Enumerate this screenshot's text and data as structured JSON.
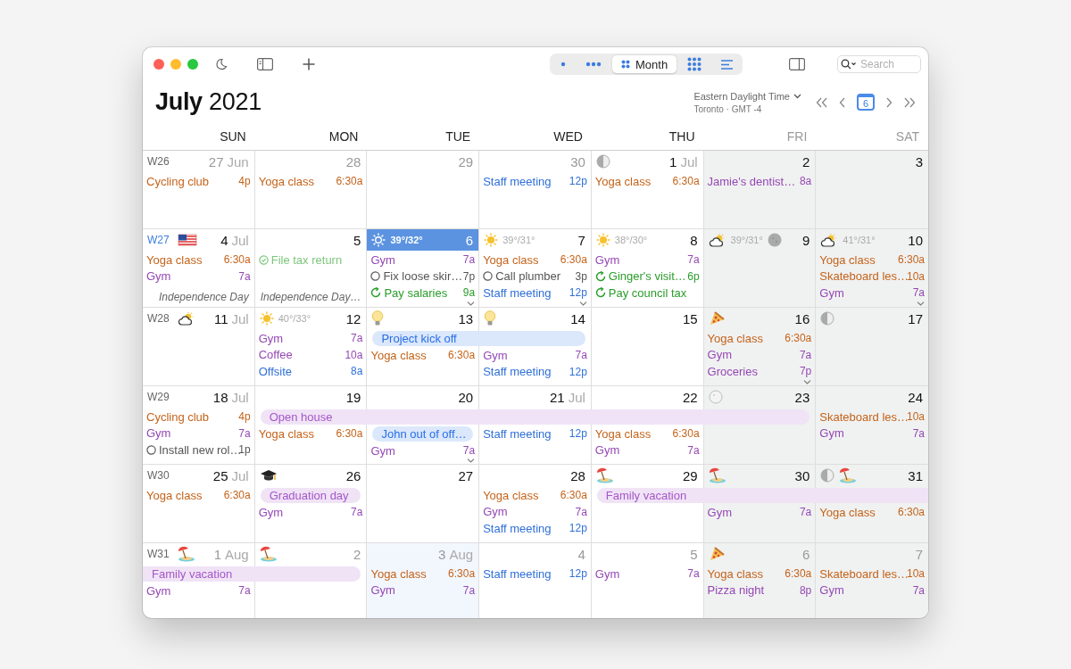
{
  "view_modes": [
    {
      "kind": "day",
      "selected": false
    },
    {
      "kind": "week",
      "selected": false
    },
    {
      "kind": "month",
      "label": "Month",
      "selected": true
    },
    {
      "kind": "year",
      "selected": false
    },
    {
      "kind": "list",
      "selected": false
    }
  ],
  "search": {
    "placeholder": "Search"
  },
  "title": "**July** 2021",
  "timezone": {
    "name": "Eastern Daylight Time",
    "detail": "Toronto · GMT -4"
  },
  "today_button": "6",
  "weekdays": [
    {
      "label": "SUN",
      "muted": false
    },
    {
      "label": "MON",
      "muted": false
    },
    {
      "label": "TUE",
      "muted": false
    },
    {
      "label": "WED",
      "muted": false
    },
    {
      "label": "THU",
      "muted": false
    },
    {
      "label": "FRI",
      "muted": true
    },
    {
      "label": "SAT",
      "muted": true
    }
  ],
  "weeks": [
    {
      "label": "W26",
      "selected": false,
      "days": [
        {
          "number": "27",
          "month": "Jun",
          "muted": true,
          "shaded": false,
          "selected": false,
          "events": [
            {
              "kind": "event",
              "title": "Cycling club",
              "time": "4p",
              "color": "#c4631a"
            }
          ]
        },
        {
          "number": "28",
          "muted": true,
          "shaded": false,
          "selected": false,
          "events": [
            {
              "kind": "event",
              "title": "Yoga class",
              "time": "6:30a",
              "color": "#c4631a"
            }
          ]
        },
        {
          "number": "29",
          "muted": true,
          "shaded": false,
          "selected": false
        },
        {
          "number": "30",
          "muted": true,
          "shaded": false,
          "selected": false,
          "events": [
            {
              "kind": "event",
              "title": "Staff meeting",
              "time": "12p",
              "color": "#2f6fd8"
            }
          ]
        },
        {
          "number": "1",
          "month": "Jul",
          "muted": false,
          "shaded": false,
          "selected": false,
          "icons": [
            {
              "kind": "moon-half"
            }
          ],
          "events": [
            {
              "kind": "event",
              "title": "Yoga class",
              "time": "6:30a",
              "color": "#c4631a"
            }
          ]
        },
        {
          "number": "2",
          "muted": false,
          "shaded": true,
          "selected": false,
          "events": [
            {
              "kind": "event",
              "title": "Jamie's dentist…",
              "time": "8a",
              "color": "#9448b4"
            }
          ]
        },
        {
          "number": "3",
          "muted": false,
          "shaded": true,
          "selected": false
        }
      ]
    },
    {
      "label": "W27",
      "selected": true,
      "days": [
        {
          "number": "4",
          "month": "Jul",
          "muted": false,
          "shaded": false,
          "selected": false,
          "icons": [
            {
              "kind": "flag"
            }
          ],
          "events": [
            {
              "kind": "event",
              "title": "Yoga class",
              "time": "6:30a",
              "color": "#c4631a"
            },
            {
              "kind": "event",
              "title": "Gym",
              "time": "7a",
              "color": "#9448b4"
            }
          ],
          "holiday": "Independence Day"
        },
        {
          "number": "5",
          "muted": false,
          "shaded": false,
          "selected": false,
          "events": [
            {
              "kind": "done",
              "title": "File tax return",
              "color": "#7cc67c"
            }
          ],
          "holiday": "Independence Day…"
        },
        {
          "number": "6",
          "muted": false,
          "shaded": false,
          "selected": true,
          "weather": {
            "kind": "sun",
            "temp": "39°/32°"
          },
          "events": [
            {
              "kind": "event",
              "title": "Gym",
              "time": "7a",
              "color": "#9448b4"
            },
            {
              "kind": "todo",
              "title": "Fix loose skir…",
              "time": "7p",
              "color": "#555555"
            },
            {
              "kind": "repeat",
              "title": "Pay salaries",
              "time": "9a",
              "color": "#2a9d2a"
            }
          ],
          "more": true
        },
        {
          "number": "7",
          "muted": false,
          "shaded": false,
          "selected": false,
          "weather": {
            "kind": "sun",
            "temp": "39°/31°"
          },
          "events": [
            {
              "kind": "event",
              "title": "Yoga class",
              "time": "6:30a",
              "color": "#c4631a"
            },
            {
              "kind": "todo",
              "title": "Call plumber",
              "time": "3p",
              "color": "#555555"
            },
            {
              "kind": "event",
              "title": "Staff meeting",
              "time": "12p",
              "color": "#2f6fd8"
            }
          ],
          "more": true
        },
        {
          "number": "8",
          "muted": false,
          "shaded": false,
          "selected": false,
          "weather": {
            "kind": "sun",
            "temp": "38°/30°"
          },
          "events": [
            {
              "kind": "event",
              "title": "Gym",
              "time": "7a",
              "color": "#9448b4"
            },
            {
              "kind": "repeat",
              "title": "Ginger's visit…",
              "time": "6p",
              "color": "#2a9d2a"
            },
            {
              "kind": "repeat",
              "title": "Pay council tax",
              "color": "#2a9d2a"
            }
          ]
        },
        {
          "number": "9",
          "muted": false,
          "shaded": true,
          "selected": false,
          "weather": {
            "kind": "cloud-sun",
            "temp": "39°/31°"
          },
          "icons": [
            {
              "kind": "moon-full"
            }
          ]
        },
        {
          "number": "10",
          "muted": false,
          "shaded": true,
          "selected": false,
          "weather": {
            "kind": "cloud-sun",
            "temp": "41°/31°"
          },
          "events": [
            {
              "kind": "event",
              "title": "Yoga class",
              "time": "6:30a",
              "color": "#c4631a"
            },
            {
              "kind": "event",
              "title": "Skateboard les…",
              "time": "10a",
              "color": "#c4631a"
            },
            {
              "kind": "event",
              "title": "Gym",
              "time": "7a",
              "color": "#9448b4"
            }
          ],
          "more": true
        }
      ]
    },
    {
      "label": "W28",
      "selected": false,
      "days": [
        {
          "number": "11",
          "month": "Jul",
          "muted": false,
          "shaded": false,
          "selected": false,
          "weather": {
            "kind": "cloud-sun"
          }
        },
        {
          "number": "12",
          "muted": false,
          "shaded": false,
          "selected": false,
          "weather": {
            "kind": "sun",
            "temp": "40°/33°"
          },
          "events": [
            {
              "kind": "event",
              "title": "Gym",
              "time": "7a",
              "color": "#9448b4"
            },
            {
              "kind": "event",
              "title": "Coffee",
              "time": "10a",
              "color": "#9448b4"
            },
            {
              "kind": "event",
              "title": "Offsite",
              "time": "8a",
              "color": "#2f6fd8"
            }
          ]
        },
        {
          "number": "13",
          "muted": false,
          "shaded": false,
          "selected": false,
          "icons": [
            {
              "kind": "bulb"
            }
          ],
          "bars": [
            {
              "text": "Project kick off",
              "kind": "start",
              "color": "#dbe7fb"
            }
          ],
          "events": [
            {
              "kind": "event",
              "title": "Yoga class",
              "time": "6:30a",
              "color": "#c4631a"
            }
          ]
        },
        {
          "number": "14",
          "muted": false,
          "shaded": false,
          "selected": false,
          "icons": [
            {
              "kind": "bulb"
            }
          ],
          "bars": [
            {
              "kind": "end",
              "color": "#dbe7fb"
            }
          ],
          "events": [
            {
              "kind": "event",
              "title": "Gym",
              "time": "7a",
              "color": "#9448b4"
            },
            {
              "kind": "event",
              "title": "Staff meeting",
              "time": "12p",
              "color": "#2f6fd8"
            }
          ]
        },
        {
          "number": "15",
          "muted": false,
          "shaded": false,
          "selected": false
        },
        {
          "number": "16",
          "muted": false,
          "shaded": true,
          "selected": false,
          "icons": [
            {
              "kind": "pizza"
            }
          ],
          "events": [
            {
              "kind": "event",
              "title": "Yoga class",
              "time": "6:30a",
              "color": "#c4631a"
            },
            {
              "kind": "event",
              "title": "Gym",
              "time": "7a",
              "color": "#9448b4"
            },
            {
              "kind": "event",
              "title": "Groceries",
              "time": "7p",
              "color": "#9448b4"
            }
          ],
          "more": true
        },
        {
          "number": "17",
          "muted": false,
          "shaded": true,
          "selected": false,
          "icons": [
            {
              "kind": "moon-half"
            }
          ]
        }
      ]
    },
    {
      "label": "W29",
      "selected": false,
      "days": [
        {
          "number": "18",
          "month": "Jul",
          "muted": false,
          "shaded": false,
          "selected": false,
          "events": [
            {
              "kind": "event",
              "title": "Cycling club",
              "time": "4p",
              "color": "#c4631a"
            },
            {
              "kind": "event",
              "title": "Gym",
              "time": "7a",
              "color": "#9448b4"
            },
            {
              "kind": "todo",
              "title": "Install new rol…",
              "time": "1p",
              "color": "#555555"
            }
          ]
        },
        {
          "number": "19",
          "muted": false,
          "shaded": false,
          "selected": false,
          "bars": [
            {
              "text": "Open house",
              "kind": "start",
              "color": "#f0e3f6"
            }
          ],
          "events": [
            {
              "kind": "event",
              "title": "Yoga class",
              "time": "6:30a",
              "color": "#c4631a"
            }
          ]
        },
        {
          "number": "20",
          "muted": false,
          "shaded": false,
          "selected": false,
          "bars": [
            {
              "kind": "middle",
              "color": "#f0e3f6"
            },
            {
              "text": "John out of off…",
              "kind": "single",
              "color": "#dbe7fb"
            }
          ],
          "events": [
            {
              "kind": "event",
              "title": "Gym",
              "time": "7a",
              "color": "#9448b4"
            }
          ],
          "more": true
        },
        {
          "number": "21",
          "month": "Jul",
          "muted": false,
          "shaded": false,
          "selected": false,
          "bars": [
            {
              "kind": "middle",
              "color": "#f0e3f6"
            }
          ],
          "events": [
            {
              "kind": "event",
              "title": "Staff meeting",
              "time": "12p",
              "color": "#2f6fd8"
            }
          ]
        },
        {
          "number": "22",
          "muted": false,
          "shaded": false,
          "selected": false,
          "bars": [
            {
              "kind": "middle",
              "color": "#f0e3f6"
            }
          ],
          "events": [
            {
              "kind": "event",
              "title": "Yoga class",
              "time": "6:30a",
              "color": "#c4631a"
            },
            {
              "kind": "event",
              "title": "Gym",
              "time": "7a",
              "color": "#9448b4"
            }
          ]
        },
        {
          "number": "23",
          "muted": false,
          "shaded": true,
          "selected": false,
          "icons": [
            {
              "kind": "moon-new"
            }
          ],
          "bars": [
            {
              "kind": "end",
              "color": "#f0e3f6"
            }
          ]
        },
        {
          "number": "24",
          "muted": false,
          "shaded": true,
          "selected": false,
          "events": [
            {
              "kind": "event",
              "title": "Skateboard les…",
              "time": "10a",
              "color": "#c4631a"
            },
            {
              "kind": "event",
              "title": "Gym",
              "time": "7a",
              "color": "#9448b4"
            }
          ]
        }
      ]
    },
    {
      "label": "W30",
      "selected": false,
      "days": [
        {
          "number": "25",
          "month": "Jul",
          "muted": false,
          "shaded": false,
          "selected": false,
          "events": [
            {
              "kind": "event",
              "title": "Yoga class",
              "time": "6:30a",
              "color": "#c4631a"
            }
          ]
        },
        {
          "number": "26",
          "muted": false,
          "shaded": false,
          "selected": false,
          "icons": [
            {
              "kind": "cap"
            }
          ],
          "bars": [
            {
              "text": "Graduation day",
              "kind": "single",
              "color": "#f0e3f6"
            }
          ],
          "events": [
            {
              "kind": "event",
              "title": "Gym",
              "time": "7a",
              "color": "#9448b4"
            }
          ]
        },
        {
          "number": "27",
          "muted": false,
          "shaded": false,
          "selected": false
        },
        {
          "number": "28",
          "muted": false,
          "shaded": false,
          "selected": false,
          "events": [
            {
              "kind": "event",
              "title": "Yoga class",
              "time": "6:30a",
              "color": "#c4631a"
            },
            {
              "kind": "event",
              "title": "Gym",
              "time": "7a",
              "color": "#9448b4"
            },
            {
              "kind": "event",
              "title": "Staff meeting",
              "time": "12p",
              "color": "#2f6fd8"
            }
          ]
        },
        {
          "number": "29",
          "muted": false,
          "shaded": false,
          "selected": false,
          "icons": [
            {
              "kind": "beach"
            }
          ],
          "bars": [
            {
              "text": "Family vacation",
              "kind": "start",
              "color": "#f0e3f6"
            }
          ]
        },
        {
          "number": "30",
          "muted": false,
          "shaded": true,
          "selected": false,
          "icons": [
            {
              "kind": "beach"
            }
          ],
          "bars": [
            {
              "kind": "middle",
              "color": "#f0e3f6"
            }
          ],
          "events": [
            {
              "kind": "event",
              "title": "Gym",
              "time": "7a",
              "color": "#9448b4"
            }
          ]
        },
        {
          "number": "31",
          "muted": false,
          "shaded": true,
          "selected": false,
          "icons": [
            {
              "kind": "moon-half"
            },
            {
              "kind": "beach"
            }
          ],
          "bars": [
            {
              "kind": "middle",
              "color": "#f0e3f6"
            }
          ],
          "events": [
            {
              "kind": "event",
              "title": "Yoga class",
              "time": "6:30a",
              "color": "#c4631a"
            }
          ]
        }
      ]
    },
    {
      "label": "W31",
      "selected": false,
      "days": [
        {
          "number": "1",
          "month": "Aug",
          "muted": true,
          "shaded": false,
          "selected": false,
          "icons": [
            {
              "kind": "beach"
            }
          ],
          "bars": [
            {
              "text": "Family vacation",
              "kind": "middle",
              "color": "#f0e3f6"
            }
          ],
          "events": [
            {
              "kind": "event",
              "title": "Gym",
              "time": "7a",
              "color": "#9448b4"
            }
          ]
        },
        {
          "number": "2",
          "muted": true,
          "shaded": false,
          "selected": false,
          "icons": [
            {
              "kind": "beach"
            }
          ],
          "bars": [
            {
              "kind": "end",
              "color": "#f0e3f6"
            }
          ]
        },
        {
          "number": "3",
          "month": "Aug",
          "muted": true,
          "shaded": false,
          "selected": false,
          "highlighted": true,
          "events": [
            {
              "kind": "event",
              "title": "Yoga class",
              "time": "6:30a",
              "color": "#c4631a"
            },
            {
              "kind": "event",
              "title": "Gym",
              "time": "7a",
              "color": "#9448b4"
            }
          ]
        },
        {
          "number": "4",
          "muted": true,
          "shaded": false,
          "selected": false,
          "events": [
            {
              "kind": "event",
              "title": "Staff meeting",
              "time": "12p",
              "color": "#2f6fd8"
            }
          ]
        },
        {
          "number": "5",
          "muted": true,
          "shaded": false,
          "selected": false,
          "events": [
            {
              "kind": "event",
              "title": "Gym",
              "time": "7a",
              "color": "#9448b4"
            }
          ]
        },
        {
          "number": "6",
          "muted": true,
          "shaded": true,
          "selected": false,
          "icons": [
            {
              "kind": "pizza"
            }
          ],
          "events": [
            {
              "kind": "event",
              "title": "Yoga class",
              "time": "6:30a",
              "color": "#c4631a"
            },
            {
              "kind": "event",
              "title": "Pizza night",
              "time": "8p",
              "color": "#9448b4"
            }
          ]
        },
        {
          "number": "7",
          "muted": true,
          "shaded": true,
          "selected": false,
          "events": [
            {
              "kind": "event",
              "title": "Skateboard les…",
              "time": "10a",
              "color": "#c4631a"
            },
            {
              "kind": "event",
              "title": "Gym",
              "time": "7a",
              "color": "#9448b4"
            }
          ]
        }
      ]
    }
  ]
}
